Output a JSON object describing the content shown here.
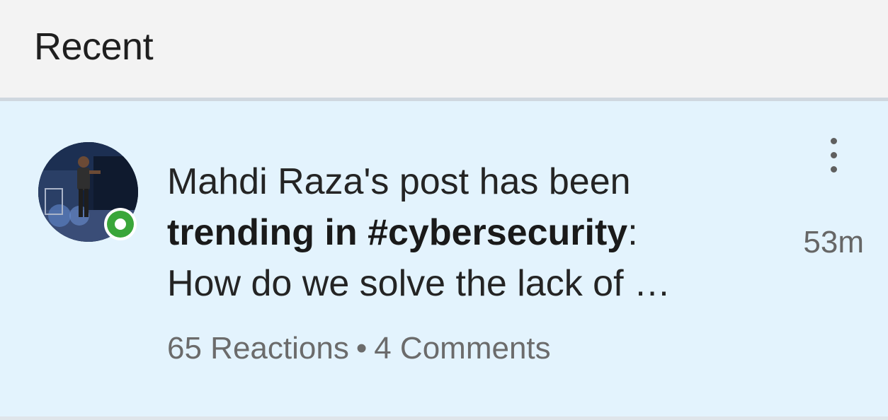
{
  "header": {
    "title": "Recent"
  },
  "notification": {
    "line1": "Mahdi Raza's post has been",
    "trend_bold": "trending in #cybersecurity",
    "trend_suffix": ":",
    "line3": "How do we solve the lack of …",
    "reactions": "65 Reactions",
    "separator": "•",
    "comments": "4 Comments",
    "time": "53m",
    "avatar_icon": "profile-photo",
    "badge_icon": "online-status-icon",
    "more_icon": "more-options-vertical-icon"
  },
  "colors": {
    "background": "#f3f3f3",
    "notification_bg": "#e3f3fd",
    "badge_green": "#3aa63a",
    "text": "#242424",
    "meta_text": "#6b6b6b"
  }
}
